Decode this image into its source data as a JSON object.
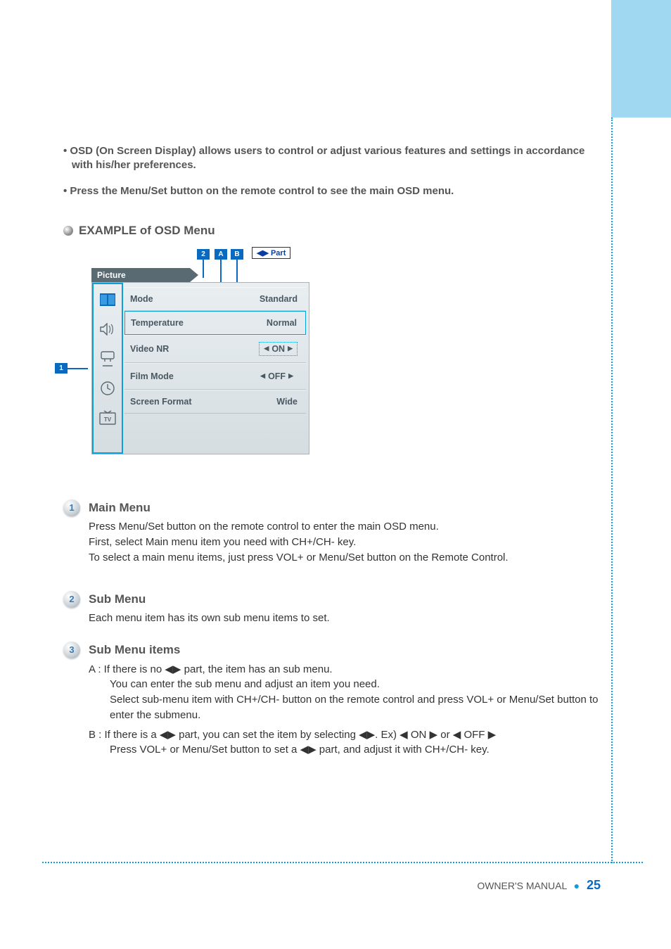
{
  "intro": {
    "line1": "OSD (On Screen Display) allows users to control or adjust various features and settings in accordance with his/her preferences.",
    "line2": "Press the Menu/Set button on the remote control to see the main OSD menu."
  },
  "section_example_title": "EXAMPLE of OSD Menu",
  "callouts": {
    "one": "1",
    "two": "2",
    "a": "A",
    "b": "B",
    "part": "◀▶ Part"
  },
  "osd": {
    "tab": "Picture",
    "rows": [
      {
        "label": "Mode",
        "value": "Standard",
        "type": "plain"
      },
      {
        "label": "Temperature",
        "value": "Normal",
        "type": "plain",
        "selected": true
      },
      {
        "label": "Video NR",
        "value": "ON",
        "type": "arrows-boxed"
      },
      {
        "label": "Film Mode",
        "value": "OFF",
        "type": "arrows"
      },
      {
        "label": "Screen Format",
        "value": "Wide",
        "type": "plain"
      }
    ],
    "icons": [
      "picture-icon",
      "sound-icon",
      "setup-icon",
      "time-icon",
      "tv-icon"
    ]
  },
  "sections": [
    {
      "num": "1",
      "title": "Main Menu",
      "lines": [
        "Press Menu/Set button on the remote control to enter the main OSD menu.",
        "First, select Main menu item you need with CH+/CH- key.",
        "To select a main menu items, just press VOL+ or Menu/Set button on the Remote Control."
      ]
    },
    {
      "num": "2",
      "title": "Sub Menu",
      "lines": [
        "Each menu item has its own sub menu items to set."
      ]
    },
    {
      "num": "3",
      "title": "Sub Menu items",
      "itemA": {
        "head": "A : If there is no ◀▶ part, the item has an sub menu.",
        "rest": [
          "You can enter the sub menu and adjust an item you need.",
          "Select sub-menu item with CH+/CH- button on the remote control and press VOL+ or Menu/Set button to enter the submenu."
        ]
      },
      "itemB": {
        "head": "B : If there is a ◀▶ part, you can set the item by selecting ◀▶. Ex) ◀ ON ▶ or ◀ OFF ▶",
        "rest": [
          "Press VOL+ or Menu/Set button to set a ◀▶ part, and adjust it with CH+/CH- key."
        ]
      }
    }
  ],
  "footer": {
    "label": "OWNER'S MANUAL",
    "page": "25"
  }
}
